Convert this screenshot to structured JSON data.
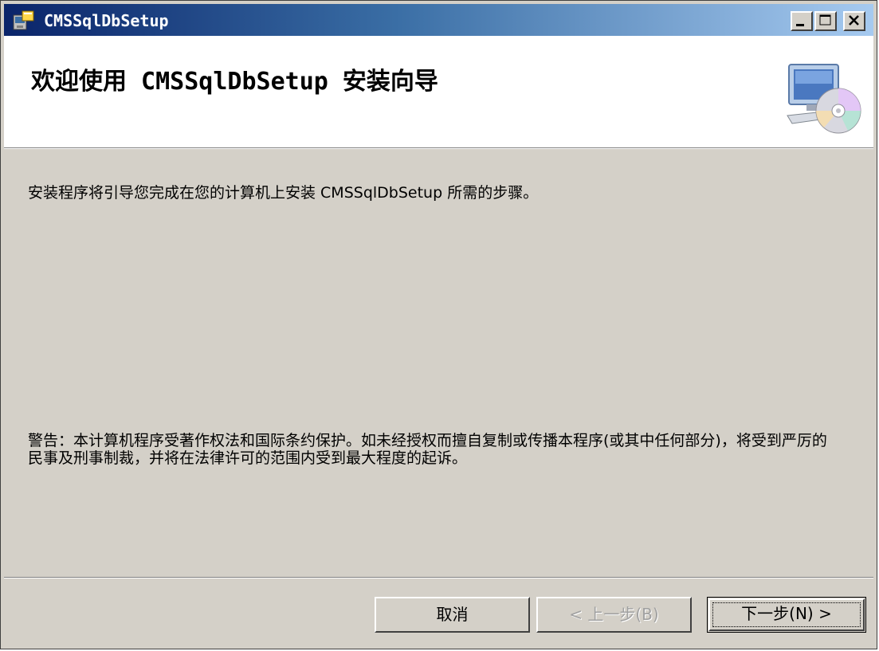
{
  "window": {
    "title": "CMSSqlDbSetup",
    "minimize_icon": "minimize-icon",
    "maximize_icon": "maximize-icon",
    "close_icon": "close-icon"
  },
  "banner": {
    "title": "欢迎使用 CMSSqlDbSetup 安装向导",
    "icon": "computer-cd-icon"
  },
  "body": {
    "intro": "安装程序将引导您完成在您的计算机上安装 CMSSqlDbSetup 所需的步骤。",
    "warning": "警告：本计算机程序受著作权法和国际条约保护。如未经授权而擅自复制或传播本程序(或其中任何部分)，将受到严厉的民事及刑事制裁，并将在法律许可的范围内受到最大程度的起诉。"
  },
  "buttons": {
    "cancel": "取消",
    "back": "< 上一步(B)",
    "next": "下一步(N) >"
  },
  "colors": {
    "titlebar_start": "#0a246a",
    "titlebar_end": "#a6caf0",
    "face": "#d4d0c8",
    "banner": "#ffffff"
  }
}
